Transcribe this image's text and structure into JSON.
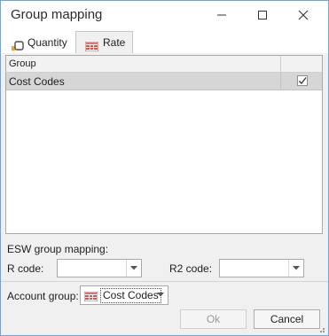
{
  "window": {
    "title": "Group mapping"
  },
  "tabs": [
    {
      "label": "Quantity",
      "icon": "quantity-icon",
      "active": false
    },
    {
      "label": "Rate",
      "icon": "rate-icon",
      "active": true
    }
  ],
  "grid": {
    "columns": [
      "Group",
      ""
    ],
    "rows": [
      {
        "name": "Cost Codes",
        "checked": true,
        "selected": true
      }
    ]
  },
  "esw": {
    "section_label": "ESW group mapping:",
    "r_code_label": "R code:",
    "r_code_value": "",
    "r2_code_label": "R2 code:",
    "r2_code_value": ""
  },
  "account": {
    "label": "Account group:",
    "value": "Cost Codes",
    "icon": "rate-icon"
  },
  "buttons": {
    "ok": "Ok",
    "cancel": "Cancel",
    "ok_enabled": false
  },
  "colors": {
    "rate_icon": "#d9534f",
    "quantity_icon": "#f0a030",
    "selected_row": "#d6d6d6"
  }
}
